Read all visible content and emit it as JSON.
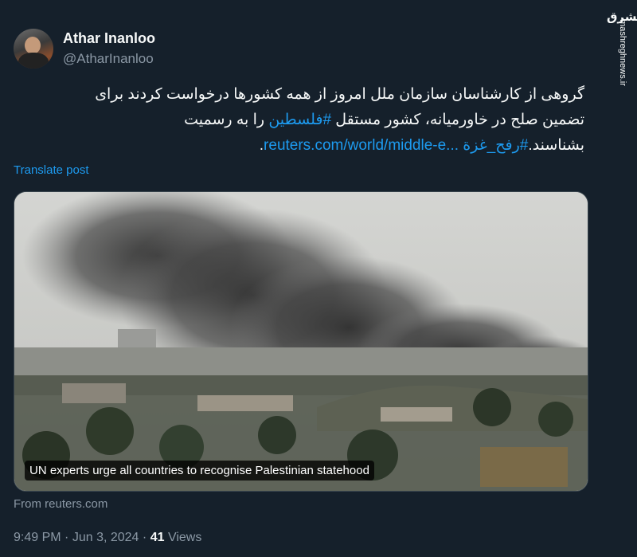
{
  "author": {
    "name": "Athar Inanloo",
    "handle": "@AtharInanloo"
  },
  "tweet": {
    "line1": "گروهی از کارشناسان سازمان ملل امروز از همه کشورها درخواست کردند برای",
    "line2_a": "تضمین صلح در خاورمیانه، کشور مستقل ",
    "line2_hashtag": "#فلسطین",
    "line2_b": " را به رسمیت",
    "line3_a": "بشناسند.",
    "line3_hashtag": "#رفح_غزة",
    "line3_url": "reuters.com/world/middle-e...",
    "line3_end": "."
  },
  "translate_label": "Translate post",
  "card": {
    "caption": "UN experts urge all countries to recognise Palestinian statehood",
    "image_description_icon": "smoke-over-city-photo"
  },
  "source": "From reuters.com",
  "meta": {
    "time": "9:49 PM",
    "separator1": "·",
    "date": "Jun 3, 2024",
    "separator2": "·",
    "views_count": "41",
    "views_label": "Views"
  },
  "watermark": {
    "logo": "مشرق",
    "url": "mashreghnews.ir"
  },
  "colors": {
    "background": "#15202b",
    "accent": "#1d9bf0",
    "secondary_text": "#8b98a5"
  }
}
